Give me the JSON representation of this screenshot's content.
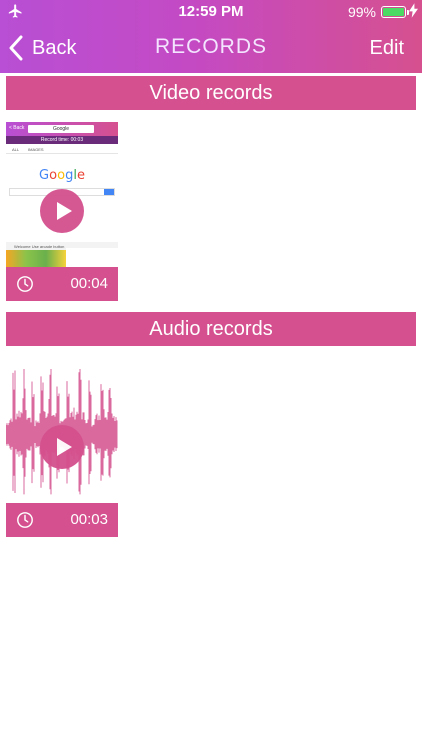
{
  "status_bar": {
    "time": "12:59 PM",
    "battery_percent": "99%",
    "battery_level": 0.99,
    "icons": [
      "airplane-icon",
      "battery-icon",
      "charging-bolt-icon"
    ]
  },
  "nav": {
    "back_label": "Back",
    "title": "RECORDS",
    "edit_label": "Edit"
  },
  "sections": {
    "video": {
      "title": "Video records",
      "items": [
        {
          "duration": "00:04",
          "thumbnail": {
            "back": "< Back",
            "url": "Google",
            "record_time": "Record time: 00:03",
            "tab_all": "ALL",
            "tab_images": "IMAGES",
            "logo": "Google",
            "strip_text": "Welcome  Use arcade button"
          }
        }
      ]
    },
    "audio": {
      "title": "Audio records",
      "items": [
        {
          "duration": "00:03"
        }
      ]
    }
  },
  "colors": {
    "accent": "#d4508e",
    "header_start": "#b84fd4",
    "header_end": "#d6508f",
    "waveform": "#d4508e"
  }
}
